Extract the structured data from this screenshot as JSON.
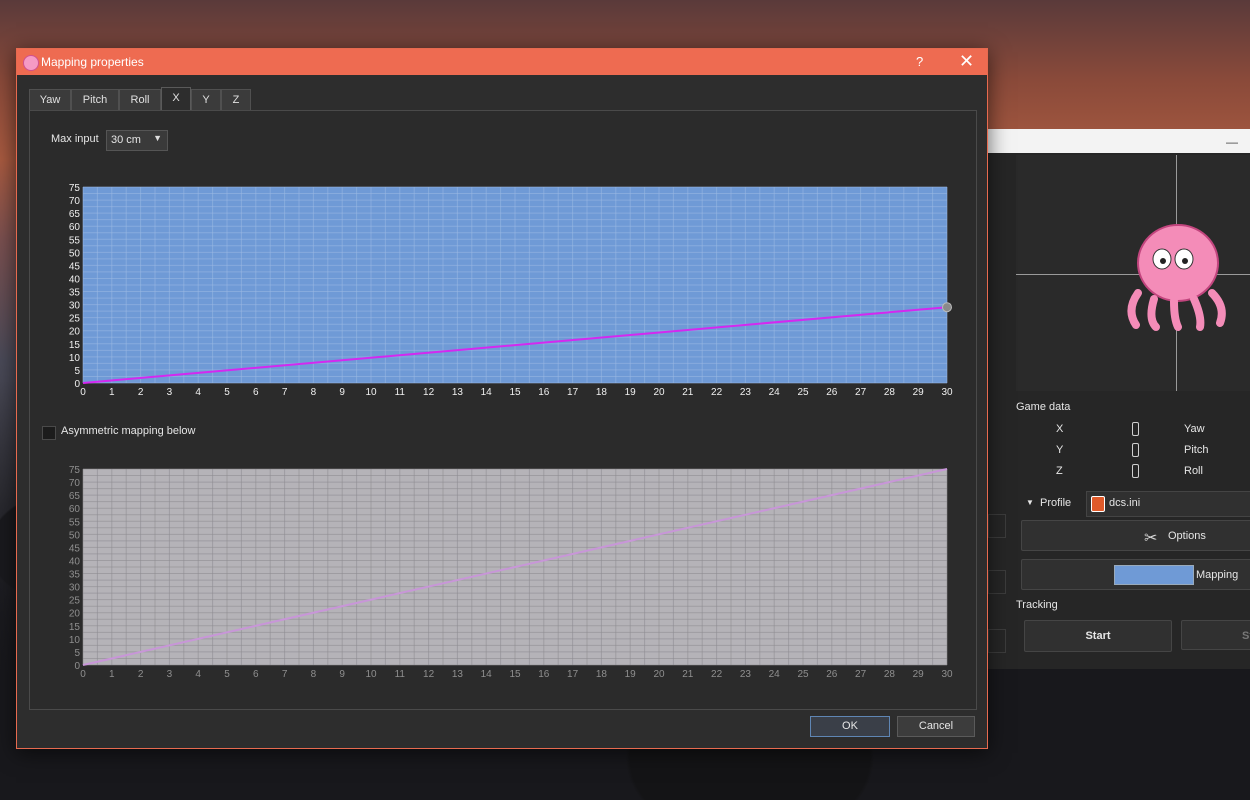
{
  "dialog": {
    "title": "Mapping properties",
    "help_label": "?",
    "close_label": "✕",
    "tabs": [
      {
        "label": "Yaw"
      },
      {
        "label": "Pitch"
      },
      {
        "label": "Roll"
      },
      {
        "label": "X"
      },
      {
        "label": "Y"
      },
      {
        "label": "Z"
      }
    ],
    "active_tab": "X",
    "max_input": {
      "label": "Max input",
      "value": "30 cm"
    },
    "asymmetric": {
      "label": "Asymmetric mapping below",
      "checked": false
    },
    "ok_label": "OK",
    "cancel_label": "Cancel"
  },
  "main_window": {
    "minimize_label": "—",
    "game_data": {
      "label": "Game data",
      "rows": [
        {
          "axis": "X",
          "value": "0",
          "rotation": "Yaw"
        },
        {
          "axis": "Y",
          "value": "0",
          "rotation": "Pitch"
        },
        {
          "axis": "Z",
          "value": "0",
          "rotation": "Roll"
        }
      ]
    },
    "profile": {
      "label": "Profile",
      "value": "dcs.ini"
    },
    "options_label": "Options",
    "mapping_label": "Mapping",
    "tracking_label": "Tracking",
    "start_label": "Start",
    "stop_label": "St"
  },
  "colors": {
    "title_bar": "#ee6b51",
    "chart_bg_active": "#6f9ad6",
    "chart_bg_inactive": "#b5b3b8",
    "curve_active": "#d428f0",
    "curve_inactive": "#c896d8"
  },
  "chart_data": [
    {
      "type": "line",
      "title": "",
      "xlabel": "",
      "ylabel": "",
      "xlim": [
        0,
        30
      ],
      "ylim": [
        0,
        75
      ],
      "x_ticks": [
        0,
        1,
        2,
        3,
        4,
        5,
        6,
        7,
        8,
        9,
        10,
        11,
        12,
        13,
        14,
        15,
        16,
        17,
        18,
        19,
        20,
        21,
        22,
        23,
        24,
        25,
        26,
        27,
        28,
        29,
        30
      ],
      "y_ticks": [
        0,
        5,
        10,
        15,
        20,
        25,
        30,
        35,
        40,
        45,
        50,
        55,
        60,
        65,
        70,
        75
      ],
      "grid": true,
      "series": [
        {
          "x": [
            0,
            30
          ],
          "y": [
            0,
            29
          ]
        }
      ],
      "control_points": [
        {
          "x": 30,
          "y": 29
        }
      ]
    },
    {
      "type": "line",
      "title": "",
      "xlabel": "",
      "ylabel": "",
      "xlim": [
        0,
        30
      ],
      "ylim": [
        0,
        75
      ],
      "x_ticks": [
        0,
        1,
        2,
        3,
        4,
        5,
        6,
        7,
        8,
        9,
        10,
        11,
        12,
        13,
        14,
        15,
        16,
        17,
        18,
        19,
        20,
        21,
        22,
        23,
        24,
        25,
        26,
        27,
        28,
        29,
        30
      ],
      "y_ticks": [
        0,
        5,
        10,
        15,
        20,
        25,
        30,
        35,
        40,
        45,
        50,
        55,
        60,
        65,
        70,
        75
      ],
      "grid": true,
      "disabled": true,
      "series": [
        {
          "x": [
            0,
            30
          ],
          "y": [
            0,
            75
          ]
        }
      ]
    }
  ]
}
